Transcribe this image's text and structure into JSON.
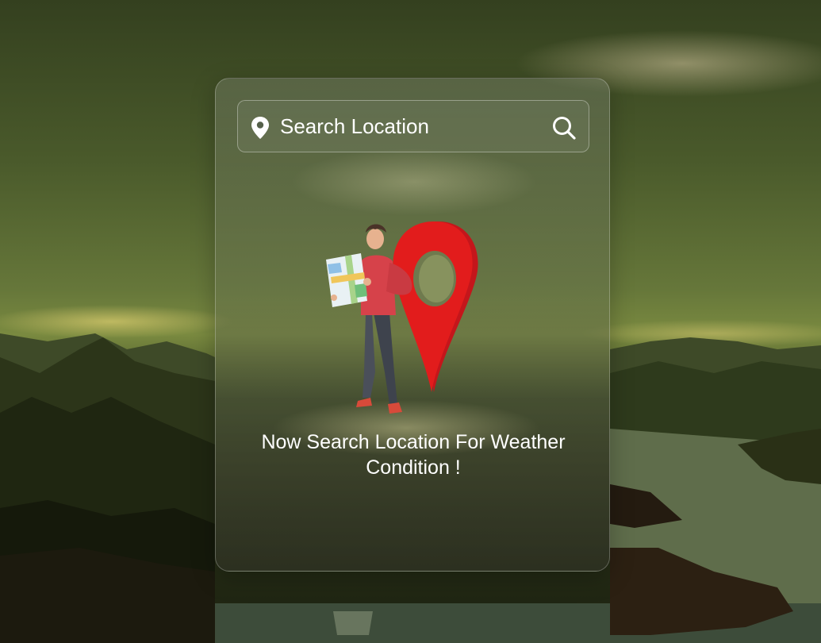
{
  "search": {
    "placeholder": "Search Location",
    "value": "",
    "leading_icon": "map-pin-icon",
    "button_icon": "search-icon"
  },
  "empty_state": {
    "illustration": "person-reading-map-with-location-pin",
    "message": "Now Search Location For Weather Condition !"
  },
  "colors": {
    "text": "#ffffff",
    "pin_red": "#e21c1c",
    "sweater_red": "#d6424a"
  }
}
